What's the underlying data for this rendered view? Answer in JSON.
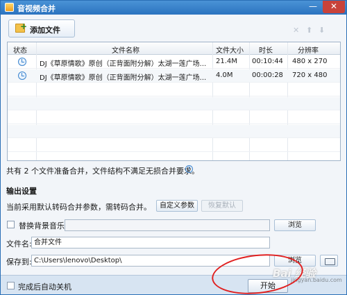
{
  "window": {
    "title": "音视频合并",
    "minimize_glyph": "—",
    "close_glyph": "✕"
  },
  "toolbar": {
    "add_file_label": "添加文件",
    "icons": [
      "folder-add-icon",
      "delete-icon",
      "move-up-icon",
      "move-down-icon"
    ],
    "delete_glyph": "✕",
    "up_glyph": "⬆",
    "down_glyph": "⬇"
  },
  "table": {
    "columns": [
      "状态",
      "文件名称",
      "文件大小",
      "时长",
      "分辨率"
    ],
    "rows": [
      {
        "status": "clock-icon",
        "name": "DJ《草原情歌》原创（正背面附分解）太湖一莲广场...",
        "size": "21.4M",
        "duration": "00:10:44",
        "resolution": "480 x 270"
      },
      {
        "status": "clock-icon",
        "name": "DJ《草原情歌》原创（正背面附分解）太湖一莲广场...",
        "size": "4.0M",
        "duration": "00:00:28",
        "resolution": "720 x 480"
      }
    ]
  },
  "summary": {
    "text": "共有 2 个文件准备合并，文件结构不满足无损合并要求。",
    "help_glyph": "?"
  },
  "output": {
    "section_title": "输出设置",
    "params_text": "当前采用默认转码合并参数，需转码合并。",
    "custom_params_label": "自定义参数",
    "restore_default_label": "恢复默认",
    "bg_music_label": "替换背景音乐",
    "bg_music_value": "",
    "browse_label": "浏览",
    "filename_label": "文件名:",
    "filename_value": "合并文件",
    "save_to_label": "保存到:",
    "save_to_value": "C:\\Users\\lenovo\\Desktop\\",
    "browse2_label": "浏览"
  },
  "footer": {
    "auto_shutdown_label": "完成后自动关机",
    "start_label": "开始"
  },
  "watermark": {
    "text": "Bai 经验",
    "sub": "jingyan.baidu.com"
  },
  "colors": {
    "title_bar": "#2b73bf",
    "accent": "#3a84cf",
    "annotation": "#e02020"
  }
}
